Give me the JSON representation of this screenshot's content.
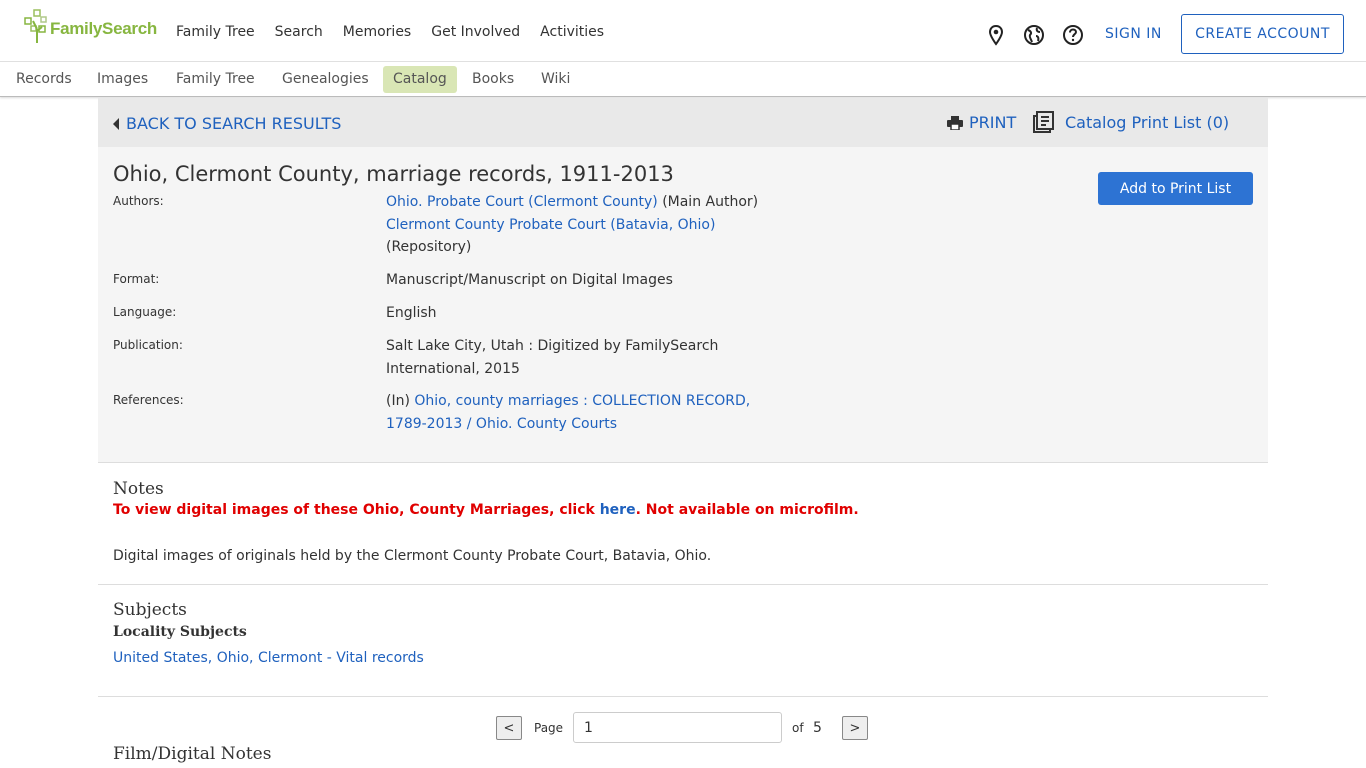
{
  "header": {
    "logo_text": "FamilySearch",
    "nav": [
      "Family Tree",
      "Search",
      "Memories",
      "Get Involved",
      "Activities"
    ],
    "sign_in": "SIGN IN",
    "create_account": "CREATE ACCOUNT",
    "icons": [
      "location-pin-icon",
      "globe-icon",
      "help-icon"
    ],
    "brand_color": "#87b640",
    "link_color": "#1f61be"
  },
  "subnav": {
    "items": [
      "Records",
      "Images",
      "Family Tree",
      "Genealogies",
      "Catalog",
      "Books",
      "Wiki"
    ],
    "active": "Catalog"
  },
  "toolbar": {
    "back": "BACK TO SEARCH RESULTS",
    "print": "PRINT",
    "print_list": "Catalog Print List (0)"
  },
  "record": {
    "title": "Ohio, Clermont County, marriage records, 1911-2013",
    "add_button": "Add to Print List",
    "authors_label": "Authors:",
    "author1_link": "Ohio. Probate Court (Clermont County)",
    "author1_role": "(Main Author)",
    "author2_link": "Clermont County Probate Court (Batavia, Ohio)",
    "author2_role": "(Repository)",
    "format_label": "Format:",
    "format": "Manuscript/Manuscript on Digital Images",
    "language_label": "Language:",
    "language": "English",
    "publication_label": "Publication:",
    "publication_line1": "Salt Lake City, Utah : Digitized by FamilySearch",
    "publication_line2": "International, 2015",
    "references_label": "References:",
    "references_prefix": "(In)",
    "references_link_line1": "Ohio, county marriages : COLLECTION RECORD,",
    "references_link_line2": "1789-2013 / Ohio. County Courts"
  },
  "notes": {
    "heading": "Notes",
    "alert_before": "To view digital images of these Ohio, County Marriages, click ",
    "alert_link": "here",
    "alert_after": ". Not available on microfilm.",
    "text": "Digital images of originals held by the Clermont County Probate Court, Batavia, Ohio."
  },
  "subjects": {
    "heading": "Subjects",
    "subheading": "Locality Subjects",
    "link": "United States, Ohio, Clermont - Vital records"
  },
  "pager": {
    "prev": "<",
    "page_label": "Page",
    "page_value": "1",
    "of_label": "of",
    "total": "5",
    "next": ">"
  },
  "film": {
    "heading": "Film/Digital Notes"
  }
}
